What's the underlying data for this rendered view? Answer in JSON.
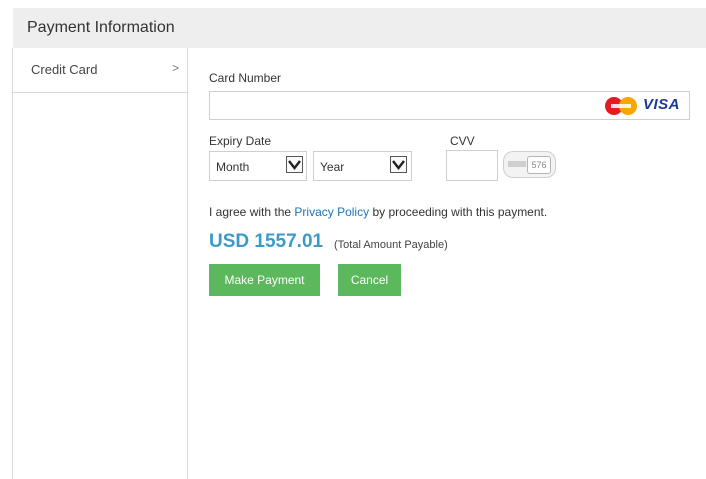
{
  "header": {
    "title": "Payment Information"
  },
  "sidebar": {
    "items": [
      {
        "label": "Credit Card",
        "chevron": ">"
      }
    ]
  },
  "form": {
    "card_number": {
      "label": "Card Number",
      "value": "",
      "placeholder": "",
      "logos": [
        "mastercard-logo",
        "visa-logo"
      ],
      "visa_text": "VISA"
    },
    "expiry": {
      "label": "Expiry Date",
      "month": {
        "selected": "Month"
      },
      "year": {
        "selected": "Year"
      }
    },
    "cvv": {
      "label": "CVV",
      "value": "",
      "sample": "576"
    },
    "agreement": {
      "prefix": "I agree with the",
      "link": "Privacy Policy",
      "suffix": "by proceeding with this payment."
    },
    "amount": {
      "value": "USD 1557.01",
      "note": "(Total Amount Payable)"
    },
    "buttons": {
      "make_payment": "Make Payment",
      "cancel": "Cancel"
    }
  },
  "colors": {
    "accent_button": "#5cb85c",
    "amount_text": "#3b9ac9",
    "link": "#1e73be",
    "header_bg": "#eeeeee"
  }
}
